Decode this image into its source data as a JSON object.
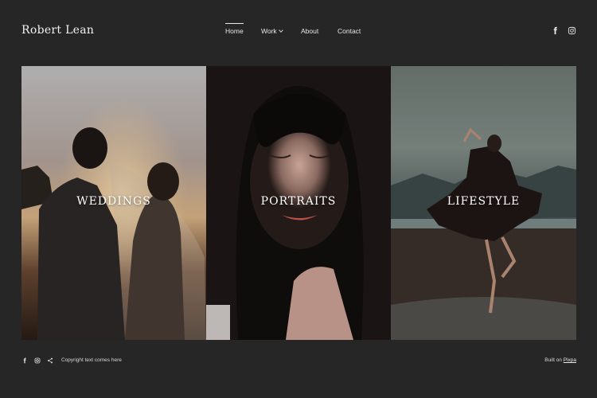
{
  "header": {
    "logo": "Robert Lean",
    "nav": [
      {
        "label": "Home"
      },
      {
        "label": "Work"
      },
      {
        "label": "About"
      },
      {
        "label": "Contact"
      }
    ],
    "social": [
      "facebook-icon",
      "instagram-icon"
    ]
  },
  "gallery": [
    {
      "label": "WEDDINGS"
    },
    {
      "label": "PORTRAITS"
    },
    {
      "label": "LIFESTYLE"
    }
  ],
  "footer": {
    "social": [
      "facebook-icon",
      "instagram-icon",
      "share-icon"
    ],
    "copyright": "Copyright text comes here",
    "built_prefix": "Built on",
    "built_link": "Pixpa"
  },
  "colors": {
    "background": "#262626",
    "text": "#ffffff"
  }
}
